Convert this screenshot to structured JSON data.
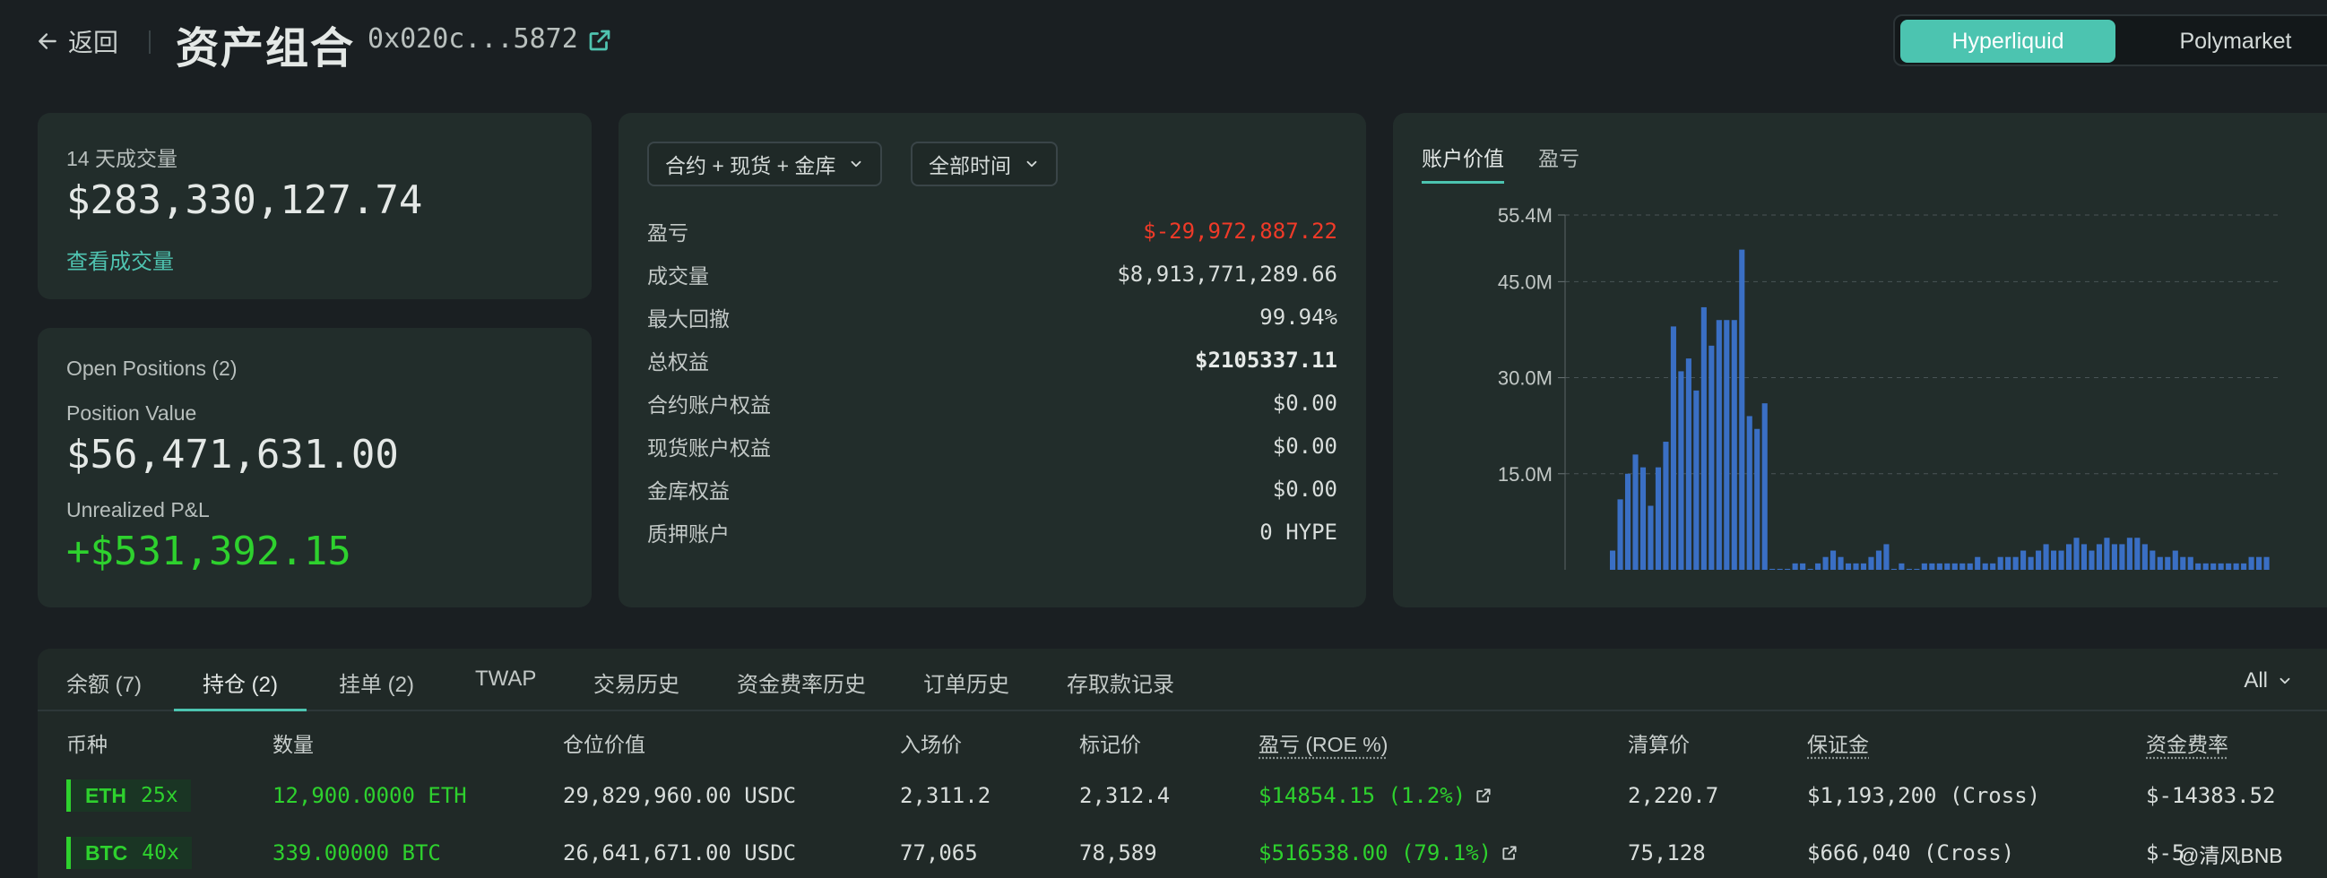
{
  "header": {
    "back_label": "返回",
    "title": "资产组合",
    "address": "0x020c...5872",
    "toggle": {
      "active": "Hyperliquid",
      "inactive": "Polymarket"
    }
  },
  "volume_card": {
    "label": "14 天成交量",
    "value": "$283,330,127.74",
    "link": "查看成交量"
  },
  "positions_card": {
    "open_positions": "Open Positions (2)",
    "position_value_label": "Position Value",
    "position_value": "$56,471,631.00",
    "unrealized_label": "Unrealized P&L",
    "unrealized_value": "+$531,392.15"
  },
  "stats_card": {
    "dropdown_scope": "合约 + 现货 + 金库",
    "dropdown_time": "全部时间",
    "rows": [
      {
        "label": "盈亏",
        "value": "$-29,972,887.22"
      },
      {
        "label": "成交量",
        "value": "$8,913,771,289.66"
      },
      {
        "label": "最大回撤",
        "value": "99.94%"
      },
      {
        "label": "总权益",
        "value": "$2105337.11"
      },
      {
        "label": "合约账户权益",
        "value": "$0.00"
      },
      {
        "label": "现货账户权益",
        "value": "$0.00"
      },
      {
        "label": "金库权益",
        "value": "$0.00"
      },
      {
        "label": "质押账户",
        "value": "0 HYPE"
      }
    ]
  },
  "chart_card": {
    "tab_active": "账户价值",
    "tab_inactive": "盈亏"
  },
  "chart_data": {
    "type": "bar",
    "ylim": [
      0,
      55.4
    ],
    "y_ticks": [
      15.0,
      30.0,
      45.0,
      55.4
    ],
    "y_tick_labels": [
      "15.0M",
      "30.0M",
      "45.0M",
      "55.4M"
    ],
    "grid": true,
    "bar_color": "#3a6fc4",
    "values": [
      3,
      11,
      15,
      18,
      16,
      10,
      16,
      20,
      38,
      31,
      33,
      28,
      41,
      35,
      39,
      39,
      39,
      50,
      24,
      22,
      26,
      0,
      0,
      0,
      1,
      1,
      0,
      1,
      2,
      3,
      2,
      1,
      1,
      1,
      2,
      3,
      4,
      0,
      1,
      0,
      0,
      1,
      1,
      1,
      1,
      1,
      1,
      1,
      2,
      1,
      1,
      2,
      2,
      2,
      3,
      2,
      3,
      4,
      3,
      3,
      4,
      5,
      4,
      3,
      4,
      5,
      4,
      4,
      5,
      5,
      4,
      3,
      2,
      2,
      3,
      2,
      2,
      1,
      1,
      1,
      1,
      1,
      1,
      1,
      2,
      2,
      2
    ]
  },
  "bottom_panel": {
    "tabs": [
      "余额 (7)",
      "持仓 (2)",
      "挂单 (2)",
      "TWAP",
      "交易历史",
      "资金费率历史",
      "订单历史",
      "存取款记录"
    ],
    "filter": "All",
    "columns": [
      "币种",
      "数量",
      "仓位价值",
      "入场价",
      "标记价",
      "盈亏 (ROE %)",
      "清算价",
      "保证金",
      "资金费率"
    ],
    "rows": [
      {
        "symbol": "ETH",
        "leverage": "25x",
        "size": "12,900.0000 ETH",
        "position_value": "29,829,960.00 USDC",
        "entry": "2,311.2",
        "mark": "2,312.4",
        "pnl": "$14854.15 (1.2%)",
        "liq": "2,220.7",
        "margin": "$1,193,200 (Cross)",
        "funding": "$-14383.52"
      },
      {
        "symbol": "BTC",
        "leverage": "40x",
        "size": "339.00000 BTC",
        "position_value": "26,641,671.00 USDC",
        "entry": "77,065",
        "mark": "78,589",
        "pnl": "$516538.00 (79.1%)",
        "liq": "75,128",
        "margin": "$666,040 (Cross)",
        "funding": "$-5"
      }
    ]
  },
  "watermark": "@清风BNB"
}
